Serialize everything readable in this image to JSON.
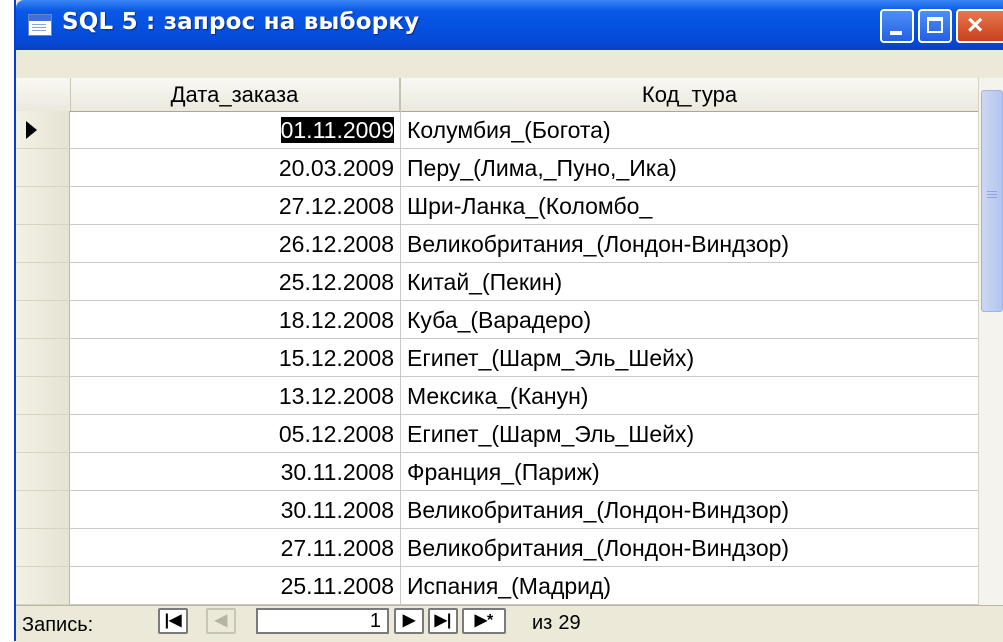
{
  "window": {
    "title": "SQL 5 : запрос на выборку"
  },
  "columns": [
    "Дата_заказа",
    "Код_тура"
  ],
  "rows": [
    {
      "date": "01.11.2009",
      "code": "Колумбия_(Богота)"
    },
    {
      "date": "20.03.2009",
      "code": "Перу_(Лима,_Пуно,_Ика)"
    },
    {
      "date": "27.12.2008",
      "code": "Шри-Ланка_(Коломбо_"
    },
    {
      "date": "26.12.2008",
      "code": "Великобритания_(Лондон-Виндзор)"
    },
    {
      "date": "25.12.2008",
      "code": "Китай_(Пекин)"
    },
    {
      "date": "18.12.2008",
      "code": "Куба_(Варадеро)"
    },
    {
      "date": "15.12.2008",
      "code": "Египет_(Шарм_Эль_Шейх)"
    },
    {
      "date": "13.12.2008",
      "code": "Мексика_(Канун)"
    },
    {
      "date": "05.12.2008",
      "code": "Египет_(Шарм_Эль_Шейх)"
    },
    {
      "date": "30.11.2008",
      "code": "Франция_(Париж)"
    },
    {
      "date": "30.11.2008",
      "code": "Великобритания_(Лондон-Виндзор)"
    },
    {
      "date": "27.11.2008",
      "code": "Великобритания_(Лондон-Виндзор)"
    },
    {
      "date": "25.11.2008",
      "code": "Испания_(Мадрид)"
    }
  ],
  "navigator": {
    "label": "Запись:",
    "first_glyph": "|◀",
    "prev_glyph": "◀",
    "current": "1",
    "next_glyph": "▶",
    "last_glyph": "▶|",
    "new_glyph": "▶*",
    "of_label": "из",
    "total": "29"
  }
}
